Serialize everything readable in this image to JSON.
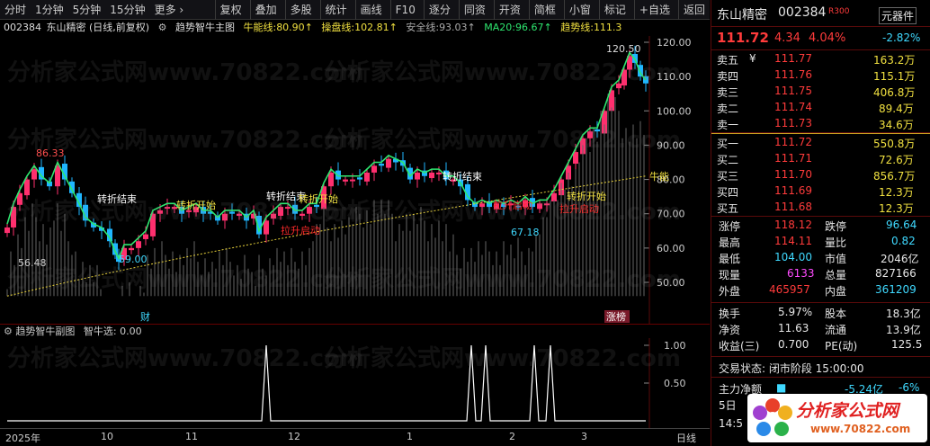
{
  "toolbar": {
    "left": [
      "分时",
      "1分钟",
      "5分钟",
      "15分钟",
      "更多 ›"
    ],
    "right": [
      "复权",
      "叠加",
      "多股",
      "统计",
      "画线",
      "F10",
      "逐分",
      "同资",
      "开资",
      "简框",
      "小窗",
      "标记",
      "+自选",
      "返回"
    ]
  },
  "stockbar": {
    "code": "002384",
    "name": "东山精密",
    "mode": "(日线,前复权)",
    "indicator": "趋势智牛主图",
    "items": [
      {
        "label": "牛能线:",
        "value": "80.90↑",
        "color": "#f0e040"
      },
      {
        "label": "操盘线:",
        "value": "102.81↑",
        "color": "#f0e040"
      },
      {
        "label": "安全线:",
        "value": "93.03↑",
        "color": "#aaaaaa"
      },
      {
        "label": "MA20:",
        "value": "96.67↑",
        "color": "#2ee66f"
      },
      {
        "label": "趋势线:",
        "value": "111.3",
        "color": "#f0e040"
      }
    ]
  },
  "main": {
    "price_axis": [
      "120.00",
      "110.00",
      "100.00",
      "90.00",
      "80.00",
      "70.00",
      "60.00",
      "50.00"
    ],
    "annotations": {
      "high": "120.50",
      "peak1": "86.33",
      "low1": "56.48",
      "low2": "59.00",
      "low3": "67.18"
    },
    "signals": [
      "转折结束",
      "转折开始",
      "转折结束",
      "转折开始",
      "转折结束",
      "转折开始"
    ],
    "red_signals": [
      "拉升启动",
      "拉升启动",
      "拉升启动"
    ],
    "cai": "财",
    "zhangbang": "涨榜",
    "niuneng": "牛能"
  },
  "sub": {
    "title": "趋势智牛副图",
    "label": "智牛选:",
    "value": "0.00",
    "axis": [
      "1.00",
      "0.50"
    ]
  },
  "dates": [
    "2025年",
    "10",
    "11",
    "12",
    "1",
    "2",
    "3"
  ],
  "period": "日线",
  "watermark": "分析家公式网www.70822.com",
  "quote": {
    "name": "东山精密",
    "code": "002384",
    "tag": "R300",
    "badge": "元器件",
    "price": "111.72",
    "change": "4.34",
    "pct": "4.04%",
    "badge_pct": "-2.82%",
    "asks": [
      [
        "卖五",
        "¥",
        "111.77",
        "163.2万"
      ],
      [
        "卖四",
        "",
        "111.76",
        "115.1万"
      ],
      [
        "卖三",
        "",
        "111.75",
        "406.8万"
      ],
      [
        "卖二",
        "",
        "111.74",
        "89.4万"
      ],
      [
        "卖一",
        "",
        "111.73",
        "34.6万"
      ]
    ],
    "bids": [
      [
        "买一",
        "111.72",
        "550.8万"
      ],
      [
        "买二",
        "111.71",
        "72.6万"
      ],
      [
        "买三",
        "111.70",
        "856.7万"
      ],
      [
        "买四",
        "111.69",
        "12.3万"
      ],
      [
        "买五",
        "111.68",
        "12.3万"
      ]
    ],
    "stats": [
      [
        "涨停",
        "118.12",
        "跌停",
        "96.64"
      ],
      [
        "最高",
        "114.11",
        "量比",
        "0.82"
      ],
      [
        "最低",
        "104.00",
        "市值",
        "2046亿"
      ],
      [
        "现量",
        "6133",
        "总量",
        "827166"
      ],
      [
        "外盘",
        "465957",
        "内盘",
        "361209"
      ]
    ],
    "stats2": [
      [
        "换手",
        "5.97%",
        "股本",
        "18.3亿"
      ],
      [
        "净资",
        "11.63",
        "流通",
        "13.9亿"
      ],
      [
        "收益(三)",
        "0.700",
        "PE(动)",
        "125.5"
      ]
    ],
    "trade_state": "交易状态: 闭市阶段 15:00:00",
    "main_flow_label": "主力净额",
    "main_flow": "-5.24亿",
    "main_flow_pct": "-6%",
    "day5": "5日",
    "time": "14:5"
  },
  "logo": {
    "text": "分析家公式网",
    "url": "www.70822.com"
  }
}
